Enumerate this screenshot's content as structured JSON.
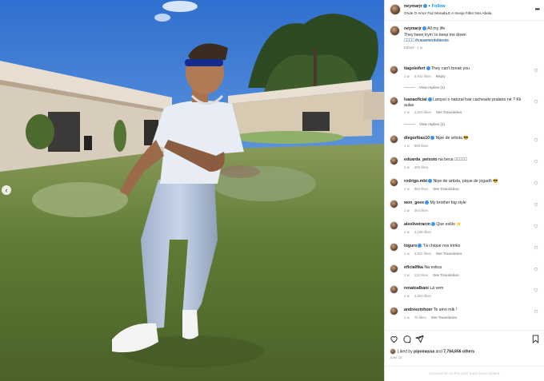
{
  "post": {
    "username": "neymarjr",
    "follow_label": "Follow",
    "separator": "•",
    "location": "Onde O Amor Faz Morada E A Inveja Fdko Nos Abala"
  },
  "caption": {
    "username": "neymarjr",
    "line1": "All my life",
    "line2": "They been tryin' to keep me down",
    "line3": "□□□□ #casamentobieois",
    "meta": "Edited · 1 w"
  },
  "comments": [
    {
      "user": "tiagoleifert",
      "text": "They can't break you",
      "time": "1 w",
      "likes": "5,641 likes",
      "action": "Reply",
      "replies": "View replies (1)"
    },
    {
      "user": "luanaoficial",
      "text": "Lançou o natural hair cacheado praiano né ? Kk",
      "text2": "aulas",
      "time": "1 w",
      "likes": "2,504 likes",
      "action": "See Translation",
      "replies": "View replies (1)"
    },
    {
      "user": "diegoribas10",
      "text": "Nipe de artista 😎",
      "time": "1 w",
      "likes": "966 likes",
      "action": ""
    },
    {
      "user": "eduarda_peixoto",
      "text": "na beca □□□□□",
      "time": "1 w",
      "likes": "480 likes",
      "action": ""
    },
    {
      "user": "rodrigo.mbt",
      "text": "Nipe de artista, pique de jogadô 😎",
      "time": "1 w",
      "likes": "884 likes",
      "action": "See Translation"
    },
    {
      "user": "won_geee",
      "text": "My brother big style",
      "time": "1 w",
      "likes": "364 likes",
      "action": ""
    },
    {
      "user": "aleoliveiracm",
      "text": "Que estilo ⭐",
      "time": "1 w",
      "likes": "2,186 likes",
      "action": ""
    },
    {
      "user": "toguro",
      "text": "Tá chique nos trinks",
      "time": "1 w",
      "likes": "3,921 likes",
      "action": "See Translation"
    },
    {
      "user": "oficialfika",
      "text": "Na estica",
      "time": "1 w",
      "likes": "132 likes",
      "action": "See Translation"
    },
    {
      "user": "renatoalbani",
      "text": "Lá vem",
      "time": "1 w",
      "likes": "2,654 likes",
      "action": ""
    },
    {
      "user": "andreezinhoer",
      "text": "Te amo mlk !",
      "time": "1 w",
      "likes": "70 likes",
      "action": "See Translation"
    }
  ],
  "footer": {
    "liked_prefix": "Liked by",
    "liked_user": "pipomassa",
    "liked_and": "and",
    "liked_count": "7,764,656 others",
    "date": "JUNE 28",
    "limited": "Comments on this post have been limited."
  },
  "icons": {
    "more": "more-horizontal-icon",
    "heart": "heart-icon",
    "comment": "comment-icon",
    "share": "share-icon",
    "save": "bookmark-icon",
    "carousel_prev": "chevron-left-icon"
  },
  "colors": {
    "link": "#0095f6",
    "verified": "#3897f0",
    "muted": "#8e8e8e"
  }
}
